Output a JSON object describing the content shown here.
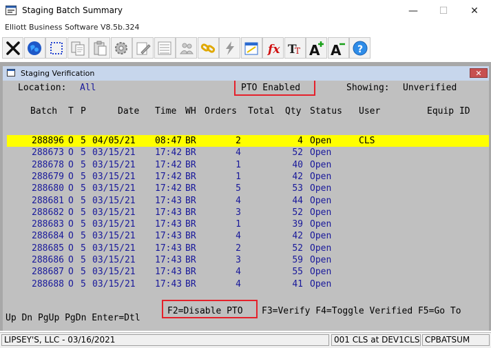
{
  "window": {
    "title": "Staging Batch Summary",
    "subtitle": "Elliott Business Software V8.5b.324",
    "minimize_glyph": "—",
    "maximize_glyph": "☐",
    "close_glyph": "✕"
  },
  "toolbar": {
    "icons": [
      "exit-icon",
      "globe-icon",
      "select-icon",
      "copy-icon",
      "paste-icon",
      "settings-icon",
      "edit-icon",
      "list-icon",
      "users-icon",
      "link-icon",
      "lightning-icon",
      "calendar-icon",
      "function-icon",
      "font-style-icon",
      "font-increase-icon",
      "font-decrease-icon",
      "help-icon"
    ]
  },
  "child_window": {
    "title": "Staging Verification",
    "close_glyph": "✕"
  },
  "header": {
    "location_label": "Location:",
    "location_value": "All",
    "pto_status": "PTO Enabled",
    "showing_label": "Showing:",
    "showing_value": "Unverified"
  },
  "columns": [
    "Batch",
    "T",
    "P",
    "Date",
    "Time",
    "WH",
    "Orders",
    "Total",
    "Qty",
    "Status",
    "User",
    "Equip ID"
  ],
  "rows": [
    {
      "batch": "288896",
      "t": "O",
      "p": "5",
      "date": "04/05/21",
      "time": "08:47",
      "wh": "BR",
      "orders": "2",
      "qty": "4",
      "status": "Open",
      "user": "CLS",
      "selected": true
    },
    {
      "batch": "288673",
      "t": "O",
      "p": "5",
      "date": "03/15/21",
      "time": "17:42",
      "wh": "BR",
      "orders": "4",
      "qty": "52",
      "status": "Open",
      "user": ""
    },
    {
      "batch": "288678",
      "t": "O",
      "p": "5",
      "date": "03/15/21",
      "time": "17:42",
      "wh": "BR",
      "orders": "1",
      "qty": "40",
      "status": "Open",
      "user": ""
    },
    {
      "batch": "288679",
      "t": "O",
      "p": "5",
      "date": "03/15/21",
      "time": "17:42",
      "wh": "BR",
      "orders": "1",
      "qty": "42",
      "status": "Open",
      "user": ""
    },
    {
      "batch": "288680",
      "t": "O",
      "p": "5",
      "date": "03/15/21",
      "time": "17:42",
      "wh": "BR",
      "orders": "5",
      "qty": "53",
      "status": "Open",
      "user": ""
    },
    {
      "batch": "288681",
      "t": "O",
      "p": "5",
      "date": "03/15/21",
      "time": "17:43",
      "wh": "BR",
      "orders": "4",
      "qty": "44",
      "status": "Open",
      "user": ""
    },
    {
      "batch": "288682",
      "t": "O",
      "p": "5",
      "date": "03/15/21",
      "time": "17:43",
      "wh": "BR",
      "orders": "3",
      "qty": "52",
      "status": "Open",
      "user": ""
    },
    {
      "batch": "288683",
      "t": "O",
      "p": "5",
      "date": "03/15/21",
      "time": "17:43",
      "wh": "BR",
      "orders": "1",
      "qty": "39",
      "status": "Open",
      "user": ""
    },
    {
      "batch": "288684",
      "t": "O",
      "p": "5",
      "date": "03/15/21",
      "time": "17:43",
      "wh": "BR",
      "orders": "4",
      "qty": "42",
      "status": "Open",
      "user": ""
    },
    {
      "batch": "288685",
      "t": "O",
      "p": "5",
      "date": "03/15/21",
      "time": "17:43",
      "wh": "BR",
      "orders": "2",
      "qty": "52",
      "status": "Open",
      "user": ""
    },
    {
      "batch": "288686",
      "t": "O",
      "p": "5",
      "date": "03/15/21",
      "time": "17:43",
      "wh": "BR",
      "orders": "3",
      "qty": "59",
      "status": "Open",
      "user": ""
    },
    {
      "batch": "288687",
      "t": "O",
      "p": "5",
      "date": "03/15/21",
      "time": "17:43",
      "wh": "BR",
      "orders": "4",
      "qty": "55",
      "status": "Open",
      "user": ""
    },
    {
      "batch": "288688",
      "t": "O",
      "p": "5",
      "date": "03/15/21",
      "time": "17:43",
      "wh": "BR",
      "orders": "4",
      "qty": "41",
      "status": "Open",
      "user": ""
    }
  ],
  "function_keys": {
    "left": "Up Dn PgUp PgDn Enter=Dtl",
    "f2": "F2=Disable PTO",
    "right": "F3=Verify F4=Toggle Verified F5=Go To"
  },
  "statusbar": {
    "company": "LIPSEY'S, LLC - 03/16/2021",
    "session": "001 CLS at DEV1CLS",
    "program": "CPBATSUM"
  },
  "colors": {
    "highlight": "#ffff00",
    "row_text": "#18189a",
    "terminal_bg": "#c0c0c0",
    "annotation_box": "#e5202a"
  }
}
